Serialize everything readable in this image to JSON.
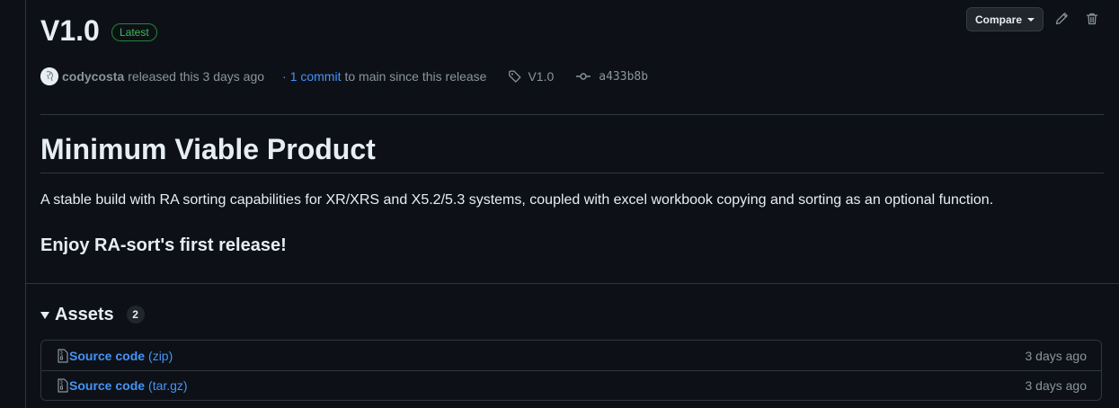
{
  "release": {
    "title": "V1.0",
    "badge": "Latest",
    "author": "codycosta",
    "released_text": "released this 3 days ago",
    "commit_prefix": "·",
    "commit_link": "1 commit",
    "commit_suffix": "to main since this release",
    "tag": "V1.0",
    "commit_hash": "a433b8b"
  },
  "actions": {
    "compare_label": "Compare"
  },
  "notes": {
    "heading": "Minimum Viable Product",
    "description": "A stable build with RA sorting capabilities for XR/XRS and X5.2/5.3 systems, coupled with excel workbook copying and sorting as an optional function.",
    "subheading": "Enjoy RA-sort's first release!"
  },
  "assets": {
    "title": "Assets",
    "count": "2",
    "items": [
      {
        "name": "Source code",
        "ext": "(zip)",
        "date": "3 days ago",
        "icon": "file-zip-icon"
      },
      {
        "name": "Source code",
        "ext": "(tar.gz)",
        "date": "3 days ago",
        "icon": "file-zip-icon"
      }
    ]
  },
  "colors": {
    "background": "#0d1117",
    "text": "#e6edf3",
    "muted": "#8b949e",
    "link": "#4493f8",
    "badge_green": "#3fb950",
    "border": "#30363d"
  }
}
